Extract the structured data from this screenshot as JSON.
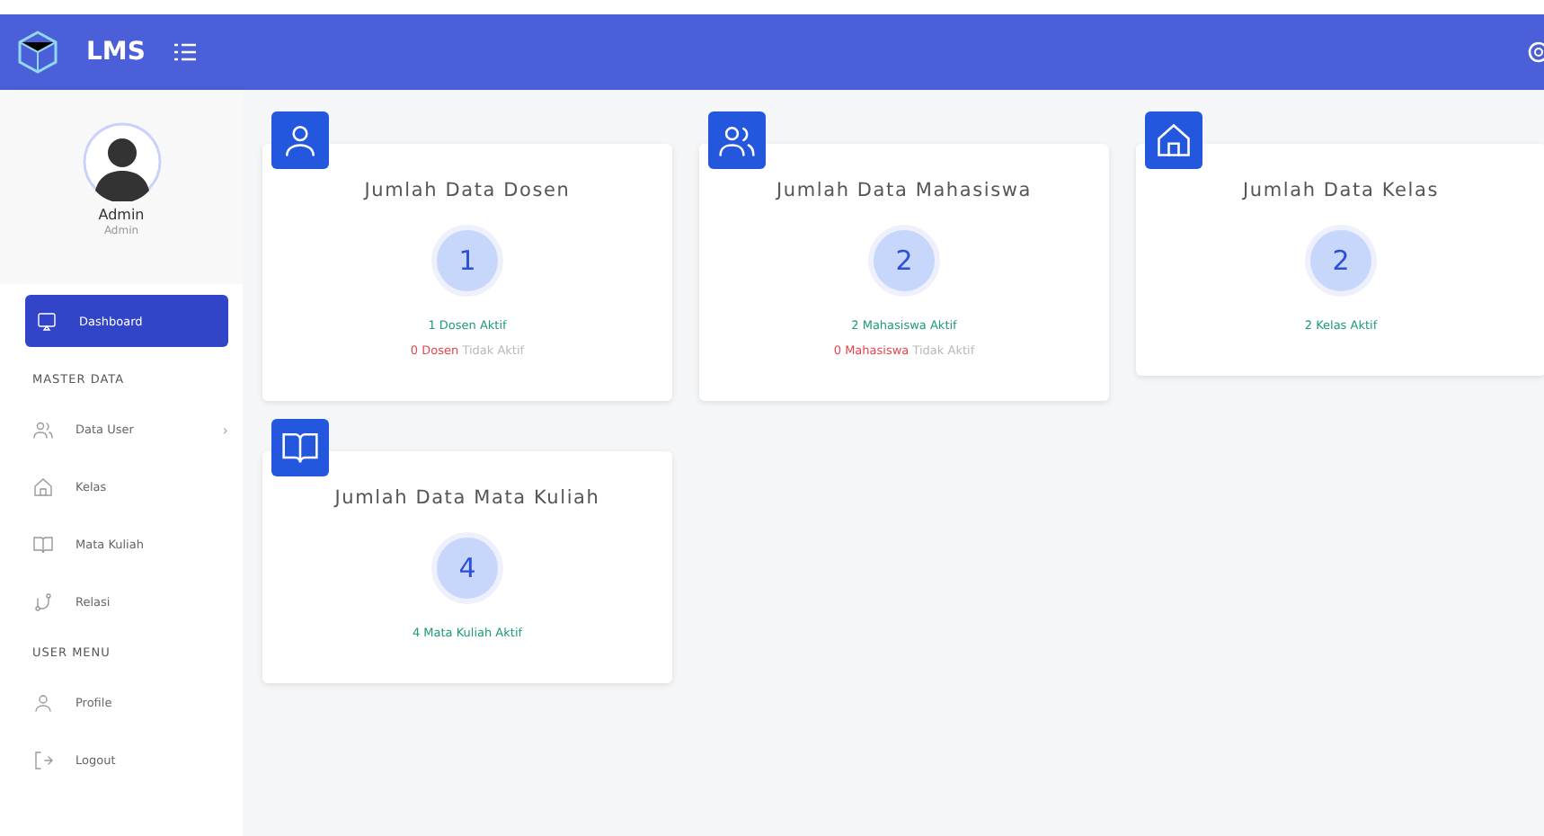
{
  "header": {
    "brand": "LMS"
  },
  "profile": {
    "name": "Admin",
    "role": "Admin"
  },
  "sidebar": [
    {
      "kind": "item",
      "label": "Dashboard",
      "selected": true
    },
    {
      "kind": "section",
      "label": "MASTER DATA"
    },
    {
      "kind": "item",
      "label": "Data User",
      "selected": false,
      "chevron": "›"
    },
    {
      "kind": "item",
      "label": "Kelas",
      "selected": false
    },
    {
      "kind": "item",
      "label": "Mata Kuliah",
      "selected": false
    },
    {
      "kind": "item",
      "label": "Relasi",
      "selected": false
    },
    {
      "kind": "section",
      "label": "USER MENU"
    },
    {
      "kind": "item",
      "label": "Profile",
      "selected": false
    },
    {
      "kind": "item",
      "label": "Logout",
      "selected": false
    }
  ],
  "cards": [
    {
      "title": "Jumlah Data Dosen",
      "count": "1",
      "lines": [
        {
          "kind": "active",
          "text": "1 Dosen Aktif"
        },
        {
          "kind": "inactive",
          "count": "0 Dosen",
          "text": "Tidak Aktif"
        }
      ]
    },
    {
      "title": "Jumlah Data Mahasiswa",
      "count": "2",
      "lines": [
        {
          "kind": "active",
          "text": "2 Mahasiswa Aktif"
        },
        {
          "kind": "inactive",
          "count": "0 Mahasiswa",
          "text": "Tidak Aktif"
        }
      ]
    },
    {
      "title": "Jumlah Data Kelas",
      "count": "2",
      "lines": [
        {
          "kind": "active",
          "text": "2 Kelas Aktif"
        }
      ]
    },
    {
      "title": "Jumlah Data Mata Kuliah",
      "count": "4",
      "lines": [
        {
          "kind": "active",
          "text": "4 Mata Kuliah Aktif"
        }
      ]
    }
  ]
}
